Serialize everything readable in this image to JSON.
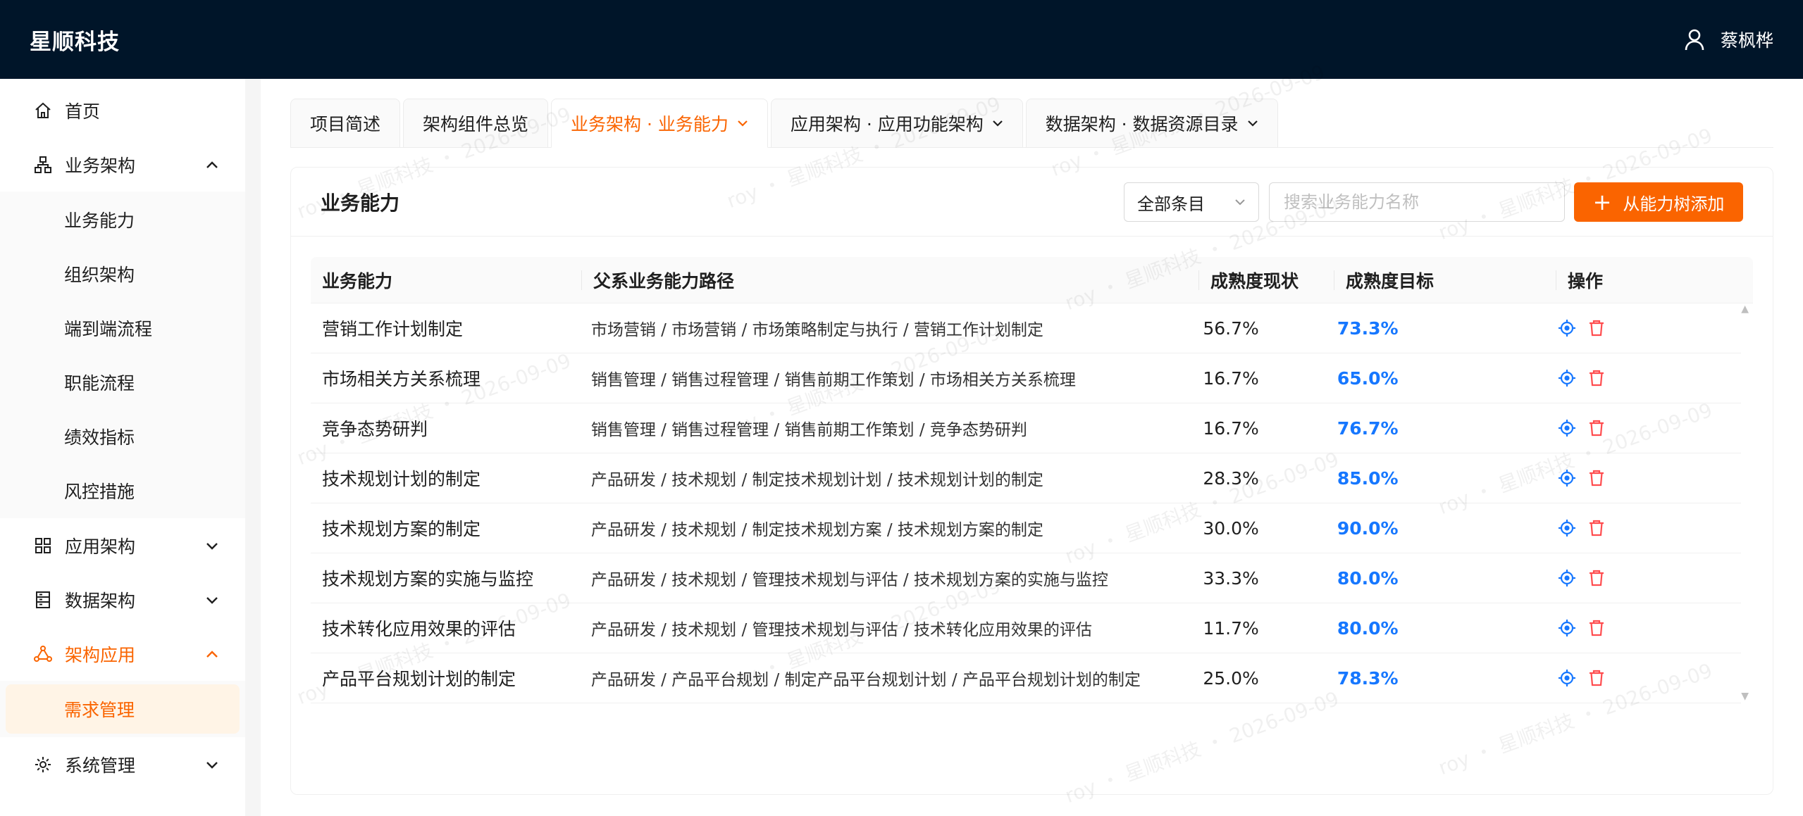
{
  "app": {
    "brand": "星顺科技",
    "user_name": "蔡枫桦"
  },
  "sidebar": {
    "items": [
      {
        "label": "首页",
        "icon": "home-icon"
      },
      {
        "label": "业务架构",
        "icon": "hierarchy-icon",
        "expanded": true,
        "children": [
          "业务能力",
          "组织架构",
          "端到端流程",
          "职能流程",
          "绩效指标",
          "风控措施"
        ]
      },
      {
        "label": "应用架构",
        "icon": "grid-icon",
        "expanded": false
      },
      {
        "label": "数据架构",
        "icon": "database-icon",
        "expanded": false
      },
      {
        "label": "架构应用",
        "icon": "nodes-icon",
        "expanded": true,
        "active": true,
        "children": [
          "需求管理"
        ]
      },
      {
        "label": "系统管理",
        "icon": "gear-icon",
        "expanded": false
      }
    ]
  },
  "tabs": [
    {
      "label": "项目简述",
      "active": false
    },
    {
      "label": "架构组件总览",
      "active": false
    },
    {
      "label": "业务架构 · 业务能力",
      "active": true,
      "dropdown": true
    },
    {
      "label": "应用架构 · 应用功能架构",
      "active": false,
      "dropdown": true
    },
    {
      "label": "数据架构 · 数据资源目录",
      "active": false,
      "dropdown": true
    }
  ],
  "card": {
    "title": "业务能力",
    "filter_value": "全部条目",
    "search_placeholder": "搜索业务能力名称",
    "add_button_label": "从能力树添加"
  },
  "table": {
    "columns": [
      "业务能力",
      "父系业务能力路径",
      "成熟度现状",
      "成熟度目标",
      "操作"
    ],
    "rows": [
      {
        "name": "营销工作计划制定",
        "path": "市场营销 / 市场营销 / 市场策略制定与执行 / 营销工作计划制定",
        "current": "56.7%",
        "target": "73.3%"
      },
      {
        "name": "市场相关方关系梳理",
        "path": "销售管理 / 销售过程管理 / 销售前期工作策划 / 市场相关方关系梳理",
        "current": "16.7%",
        "target": "65.0%"
      },
      {
        "name": "竞争态势研判",
        "path": "销售管理 / 销售过程管理 / 销售前期工作策划 / 竞争态势研判",
        "current": "16.7%",
        "target": "76.7%"
      },
      {
        "name": "技术规划计划的制定",
        "path": "产品研发 / 技术规划 / 制定技术规划计划 / 技术规划计划的制定",
        "current": "28.3%",
        "target": "85.0%"
      },
      {
        "name": "技术规划方案的制定",
        "path": "产品研发 / 技术规划 / 制定技术规划方案 / 技术规划方案的制定",
        "current": "30.0%",
        "target": "90.0%"
      },
      {
        "name": "技术规划方案的实施与监控",
        "path": "产品研发 / 技术规划 / 管理技术规划与评估 / 技术规划方案的实施与监控",
        "current": "33.3%",
        "target": "80.0%"
      },
      {
        "name": "技术转化应用效果的评估",
        "path": "产品研发 / 技术规划 / 管理技术规划与评估 / 技术转化应用效果的评估",
        "current": "11.7%",
        "target": "80.0%"
      },
      {
        "name": "产品平台规划计划的制定",
        "path": "产品研发 / 产品平台规划 / 制定产品平台规划计划 / 产品平台规划计划的制定",
        "current": "25.0%",
        "target": "78.3%"
      }
    ]
  },
  "watermark": {
    "text": "roy ・ 星顺科技 ・ 2026-09-09"
  },
  "colors": {
    "header_bg": "#001529",
    "accent": "#fa6400",
    "target_blue": "#1677ff",
    "delete_red": "#ff4d4f"
  }
}
